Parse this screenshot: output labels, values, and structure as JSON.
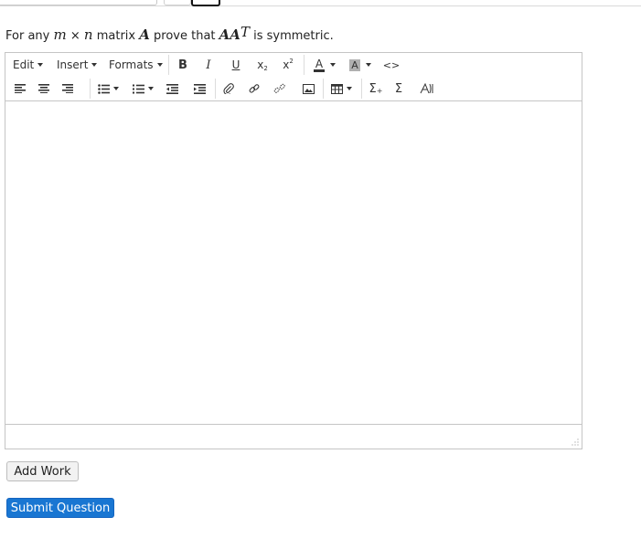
{
  "question": {
    "prefix": "For any",
    "m": "m",
    "times": "×",
    "n": "n",
    "mid": "matrix",
    "A": "A",
    "prove": "prove that",
    "AA": "AA",
    "T": "T",
    "suffix": "is symmetric."
  },
  "toolbar": {
    "menus": [
      "Edit",
      "Insert",
      "Formats"
    ],
    "bold": "B",
    "italic": "I",
    "underline": "U",
    "subscript": "x",
    "superscript": "x",
    "text_color": "A",
    "bg_color": "A",
    "source_code": "<>",
    "sum_insert": "Σ",
    "sum": "Σ"
  },
  "buttons": {
    "add_work": "Add Work",
    "submit": "Submit Question"
  },
  "colors": {
    "submit_bg": "#1976d2",
    "text_color_underline": "#333333",
    "bg_color_fill": "#b0b0b0"
  }
}
